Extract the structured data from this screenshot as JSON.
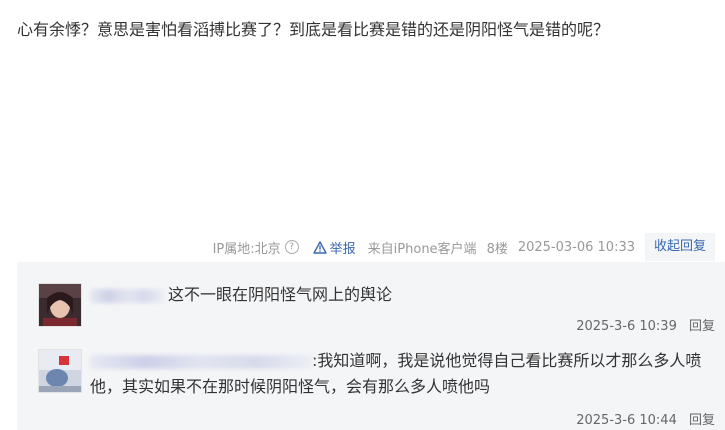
{
  "post": {
    "content": "心有余悸？意思是害怕看滔搏比赛了？到底是看比赛是错的还是阴阳怪气是错的呢？"
  },
  "meta": {
    "ip_label": "IP属地:北京",
    "help_icon": "?",
    "report_label": "举报",
    "from_label": "来自iPhone客户端",
    "floor": "8楼",
    "time": "2025-03-06 10:33",
    "collapse_label": "收起回复"
  },
  "replies": [
    {
      "text": "这不一眼在阴阳怪气网上的舆论",
      "time": "2025-3-6 10:39",
      "reply_label": "回复",
      "avatar_icon": "user-avatar-icon"
    },
    {
      "text": ":我知道啊，我是说他觉得自己看比赛所以才那么多人喷他，其实如果不在那时候阴阳怪气，会有那么多人喷他吗",
      "time": "2025-3-6 10:44",
      "reply_label": "回复",
      "avatar_icon": "user-avatar-icon"
    }
  ],
  "colors": {
    "link": "#3a68b1",
    "muted": "#999999",
    "text": "#333333",
    "sub_bg": "#f4f5f7"
  }
}
